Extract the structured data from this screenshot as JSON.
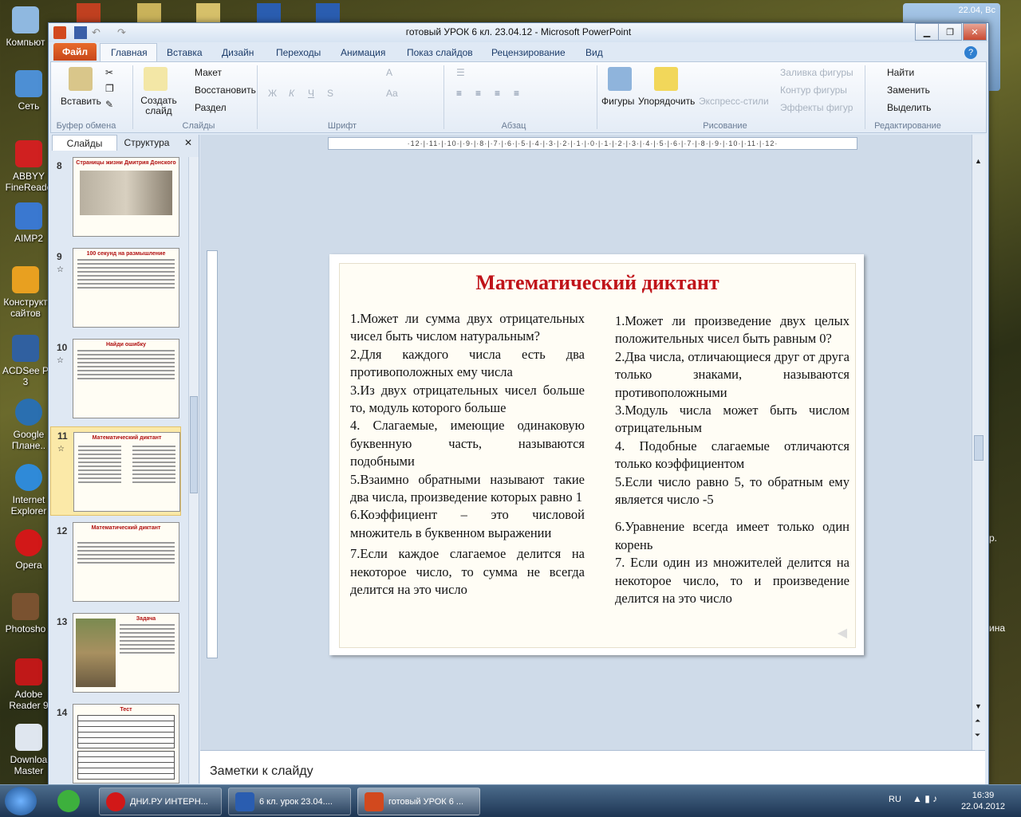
{
  "desktop": {
    "icons": [
      {
        "label": "Компьют"
      },
      {
        "label": "Сеть"
      },
      {
        "label": "ABBYY FineReade"
      },
      {
        "label": "AIMP2"
      },
      {
        "label": "Конструкт сайтов"
      },
      {
        "label": "ACDSee P 3"
      },
      {
        "label": "Google Плане.."
      },
      {
        "label": "Internet Explorer"
      },
      {
        "label": "Opera"
      },
      {
        "label": "Photosho"
      },
      {
        "label": "Adobe Reader 9"
      },
      {
        "label": "Downloa Master"
      }
    ],
    "right_fragment_1": "р.",
    "right_fragment_2": "ина",
    "gadget_date": "22.04, Вс"
  },
  "window": {
    "title": "готовый УРОК  6 кл. 23.04.12  -  Microsoft PowerPoint"
  },
  "ribbon": {
    "tabs": [
      "Файл",
      "Главная",
      "Вставка",
      "Дизайн",
      "Переходы",
      "Анимация",
      "Показ слайдов",
      "Рецензирование",
      "Вид"
    ],
    "clipboard": {
      "paste": "Вставить",
      "group": "Буфер обмена"
    },
    "slides": {
      "new_slide": "Создать слайд",
      "layout": "Макет",
      "reset": "Восстановить",
      "section": "Раздел",
      "group": "Слайды"
    },
    "font": {
      "group": "Шрифт",
      "bold": "Ж",
      "italic": "К",
      "underline": "Ч",
      "strike": "S"
    },
    "paragraph": {
      "group": "Абзац"
    },
    "drawing": {
      "shapes": "Фигуры",
      "arrange": "Упорядочить",
      "quick_styles": "Экспресс-стили",
      "fill": "Заливка фигуры",
      "outline": "Контур фигуры",
      "effects": "Эффекты фигур",
      "group": "Рисование"
    },
    "editing": {
      "find": "Найти",
      "replace": "Заменить",
      "select": "Выделить",
      "group": "Редактирование"
    }
  },
  "left_pane": {
    "tabs": [
      "Слайды",
      "Структура"
    ],
    "thumbnails": [
      {
        "num": "8",
        "title": "Страницы жизни Дмитрия Донского"
      },
      {
        "num": "9",
        "title": "100 секунд на размышление"
      },
      {
        "num": "10",
        "title": "Найди ошибку"
      },
      {
        "num": "11",
        "title": "Математический диктант"
      },
      {
        "num": "12",
        "title": "Математический диктант"
      },
      {
        "num": "13",
        "title": "Задача"
      },
      {
        "num": "14",
        "title": "Тест"
      }
    ]
  },
  "ruler": {
    "text": "·12·|·11·|·10·|·9·|·8·|·7·|·6·|·5·|·4·|·3·|·2·|·1·|·0·|·1·|·2·|·3·|·4·|·5·|·6·|·7·|·8·|·9·|·10·|·11·|·12·"
  },
  "slide": {
    "title": "Математический диктант",
    "left_items": [
      "1.Может ли сумма двух отрицательных чисел быть числом натуральным?",
      "2.Для каждого числа есть два противоположных ему числа",
      "3.Из двух отрицательных чисел больше то, модуль которого больше",
      "4. Слагаемые, имеющие одинаковую буквенную часть, называются подобными",
      "5.Взаимно обратными называют такие два числа, произведение которых равно 1",
      "6.Коэффициент – это числовой множитель в буквенном выражении",
      "7.Если каждое слагаемое делится на некоторое число, то сумма не всегда делится на это число"
    ],
    "right_items": [
      "1.Может ли произведение двух целых положительных чисел быть равным 0?",
      "2.Два числа, отличающиеся друг от друга только знаками, называются противоположными",
      "3.Модуль числа может быть числом отрицательным",
      "4. Подобные слагаемые отличаются только коэффициентом",
      "5.Если число равно 5, то обратным ему является число -5",
      "6.Уравнение всегда имеет только один корень",
      "7. Если один из множителей делится на некоторое число, то и произведение делится на это число"
    ]
  },
  "notes": {
    "placeholder": "Заметки к слайду"
  },
  "taskbar": {
    "items": [
      "ДНИ.РУ ИНТЕРН...",
      "6 кл. урок 23.04....",
      "готовый УРОК 6 ..."
    ],
    "lang": "RU",
    "time": "16:39",
    "date": "22.04.2012"
  },
  "colors": {
    "title_red": "#c0141a",
    "file_tab": "#d75a22",
    "slide_bg": "#fffdf5"
  }
}
